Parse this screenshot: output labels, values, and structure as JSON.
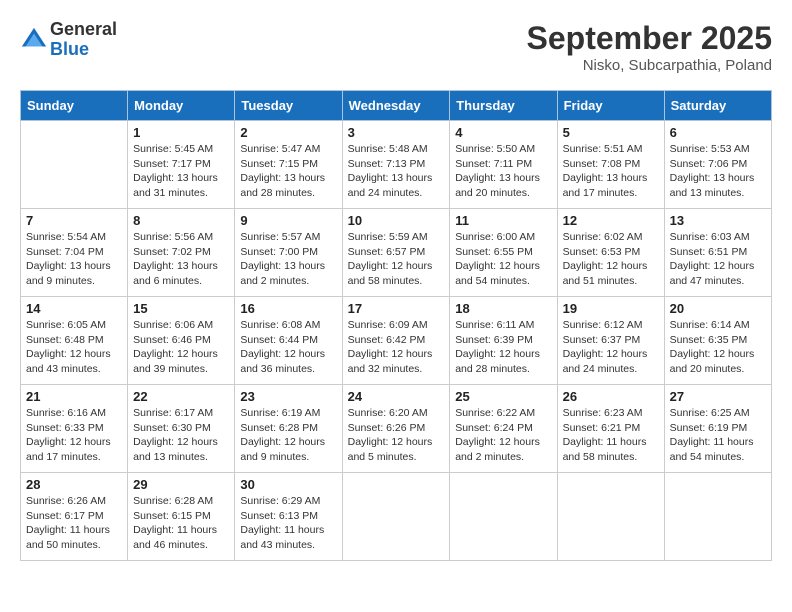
{
  "logo": {
    "general": "General",
    "blue": "Blue"
  },
  "title": "September 2025",
  "location": "Nisko, Subcarpathia, Poland",
  "days_of_week": [
    "Sunday",
    "Monday",
    "Tuesday",
    "Wednesday",
    "Thursday",
    "Friday",
    "Saturday"
  ],
  "weeks": [
    [
      {
        "day": "",
        "info": ""
      },
      {
        "day": "1",
        "info": "Sunrise: 5:45 AM\nSunset: 7:17 PM\nDaylight: 13 hours\nand 31 minutes."
      },
      {
        "day": "2",
        "info": "Sunrise: 5:47 AM\nSunset: 7:15 PM\nDaylight: 13 hours\nand 28 minutes."
      },
      {
        "day": "3",
        "info": "Sunrise: 5:48 AM\nSunset: 7:13 PM\nDaylight: 13 hours\nand 24 minutes."
      },
      {
        "day": "4",
        "info": "Sunrise: 5:50 AM\nSunset: 7:11 PM\nDaylight: 13 hours\nand 20 minutes."
      },
      {
        "day": "5",
        "info": "Sunrise: 5:51 AM\nSunset: 7:08 PM\nDaylight: 13 hours\nand 17 minutes."
      },
      {
        "day": "6",
        "info": "Sunrise: 5:53 AM\nSunset: 7:06 PM\nDaylight: 13 hours\nand 13 minutes."
      }
    ],
    [
      {
        "day": "7",
        "info": "Sunrise: 5:54 AM\nSunset: 7:04 PM\nDaylight: 13 hours\nand 9 minutes."
      },
      {
        "day": "8",
        "info": "Sunrise: 5:56 AM\nSunset: 7:02 PM\nDaylight: 13 hours\nand 6 minutes."
      },
      {
        "day": "9",
        "info": "Sunrise: 5:57 AM\nSunset: 7:00 PM\nDaylight: 13 hours\nand 2 minutes."
      },
      {
        "day": "10",
        "info": "Sunrise: 5:59 AM\nSunset: 6:57 PM\nDaylight: 12 hours\nand 58 minutes."
      },
      {
        "day": "11",
        "info": "Sunrise: 6:00 AM\nSunset: 6:55 PM\nDaylight: 12 hours\nand 54 minutes."
      },
      {
        "day": "12",
        "info": "Sunrise: 6:02 AM\nSunset: 6:53 PM\nDaylight: 12 hours\nand 51 minutes."
      },
      {
        "day": "13",
        "info": "Sunrise: 6:03 AM\nSunset: 6:51 PM\nDaylight: 12 hours\nand 47 minutes."
      }
    ],
    [
      {
        "day": "14",
        "info": "Sunrise: 6:05 AM\nSunset: 6:48 PM\nDaylight: 12 hours\nand 43 minutes."
      },
      {
        "day": "15",
        "info": "Sunrise: 6:06 AM\nSunset: 6:46 PM\nDaylight: 12 hours\nand 39 minutes."
      },
      {
        "day": "16",
        "info": "Sunrise: 6:08 AM\nSunset: 6:44 PM\nDaylight: 12 hours\nand 36 minutes."
      },
      {
        "day": "17",
        "info": "Sunrise: 6:09 AM\nSunset: 6:42 PM\nDaylight: 12 hours\nand 32 minutes."
      },
      {
        "day": "18",
        "info": "Sunrise: 6:11 AM\nSunset: 6:39 PM\nDaylight: 12 hours\nand 28 minutes."
      },
      {
        "day": "19",
        "info": "Sunrise: 6:12 AM\nSunset: 6:37 PM\nDaylight: 12 hours\nand 24 minutes."
      },
      {
        "day": "20",
        "info": "Sunrise: 6:14 AM\nSunset: 6:35 PM\nDaylight: 12 hours\nand 20 minutes."
      }
    ],
    [
      {
        "day": "21",
        "info": "Sunrise: 6:16 AM\nSunset: 6:33 PM\nDaylight: 12 hours\nand 17 minutes."
      },
      {
        "day": "22",
        "info": "Sunrise: 6:17 AM\nSunset: 6:30 PM\nDaylight: 12 hours\nand 13 minutes."
      },
      {
        "day": "23",
        "info": "Sunrise: 6:19 AM\nSunset: 6:28 PM\nDaylight: 12 hours\nand 9 minutes."
      },
      {
        "day": "24",
        "info": "Sunrise: 6:20 AM\nSunset: 6:26 PM\nDaylight: 12 hours\nand 5 minutes."
      },
      {
        "day": "25",
        "info": "Sunrise: 6:22 AM\nSunset: 6:24 PM\nDaylight: 12 hours\nand 2 minutes."
      },
      {
        "day": "26",
        "info": "Sunrise: 6:23 AM\nSunset: 6:21 PM\nDaylight: 11 hours\nand 58 minutes."
      },
      {
        "day": "27",
        "info": "Sunrise: 6:25 AM\nSunset: 6:19 PM\nDaylight: 11 hours\nand 54 minutes."
      }
    ],
    [
      {
        "day": "28",
        "info": "Sunrise: 6:26 AM\nSunset: 6:17 PM\nDaylight: 11 hours\nand 50 minutes."
      },
      {
        "day": "29",
        "info": "Sunrise: 6:28 AM\nSunset: 6:15 PM\nDaylight: 11 hours\nand 46 minutes."
      },
      {
        "day": "30",
        "info": "Sunrise: 6:29 AM\nSunset: 6:13 PM\nDaylight: 11 hours\nand 43 minutes."
      },
      {
        "day": "",
        "info": ""
      },
      {
        "day": "",
        "info": ""
      },
      {
        "day": "",
        "info": ""
      },
      {
        "day": "",
        "info": ""
      }
    ]
  ]
}
